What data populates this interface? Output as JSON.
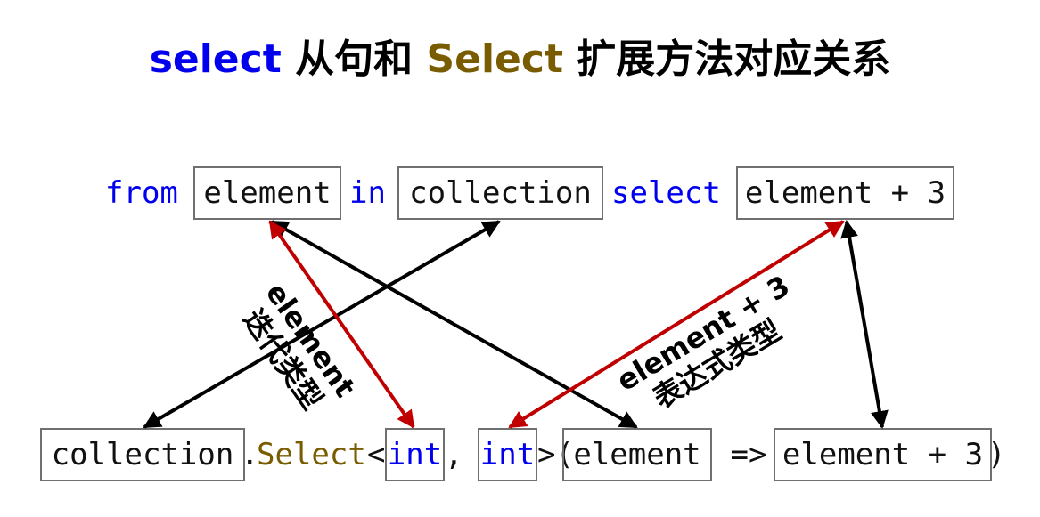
{
  "title": {
    "part1": "select",
    "part2": " 从句和 ",
    "part3": "Select",
    "part4": " 扩展方法对应关系"
  },
  "query": {
    "from": "from",
    "element": "element",
    "in": "in",
    "collection": "collection",
    "select": "select",
    "projection": "element + 3"
  },
  "method": {
    "collection": "collection",
    "dot": ".",
    "select": "Select",
    "lt": "<",
    "type1": "int",
    "comma": ", ",
    "type2": "int",
    "gt_paren": ">(",
    "param": "element",
    "lambda": " => ",
    "body": "element + 3",
    "close": ")"
  },
  "annotations": {
    "element_type_line1": "element",
    "element_type_line2": "迭代类型",
    "expr_type_line1": "element + 3",
    "expr_type_line2": "表达式类型"
  },
  "colors": {
    "keyword": "#0000ee",
    "method": "#7a5c00",
    "arrow_black": "#000000",
    "arrow_red": "#c00000"
  }
}
